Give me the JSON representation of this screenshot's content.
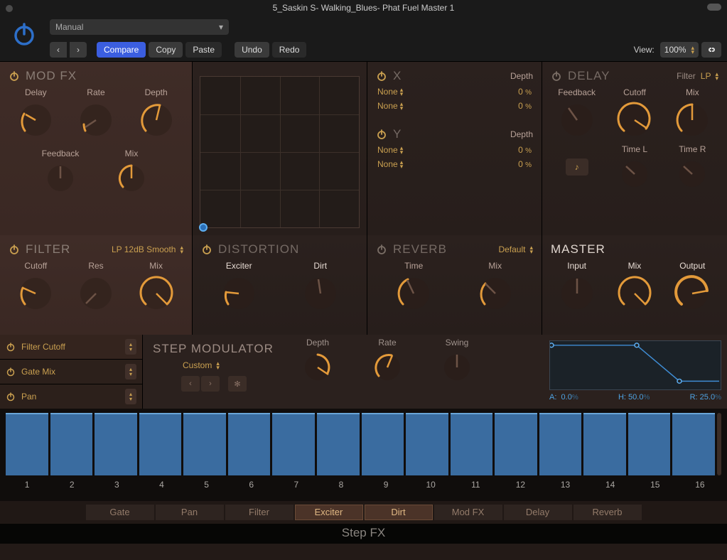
{
  "window_title": "5_Saskin S- Walking_Blues- Phat Fuel Master 1",
  "preset_name": "Manual",
  "toolbar": {
    "compare": "Compare",
    "copy": "Copy",
    "paste": "Paste",
    "undo": "Undo",
    "redo": "Redo",
    "view": "View:",
    "zoom": "100%"
  },
  "modfx": {
    "title": "MOD FX",
    "delay": "Delay",
    "rate": "Rate",
    "depth": "Depth",
    "feedback": "Feedback",
    "mix": "Mix"
  },
  "xy": {
    "x": "X",
    "y": "Y",
    "depth": "Depth",
    "none": "None",
    "vals": [
      "0",
      "0",
      "0",
      "0"
    ],
    "unit": "%"
  },
  "delay": {
    "title": "DELAY",
    "filter_label": "Filter",
    "filter_value": "LP",
    "feedback": "Feedback",
    "cutoff": "Cutoff",
    "mix": "Mix",
    "timeL": "Time L",
    "timeR": "Time R"
  },
  "filter": {
    "title": "FILTER",
    "mode": "LP 12dB Smooth",
    "cutoff": "Cutoff",
    "res": "Res",
    "mix": "Mix"
  },
  "distortion": {
    "title": "DISTORTION",
    "exciter": "Exciter",
    "dirt": "Dirt"
  },
  "reverb": {
    "title": "REVERB",
    "preset": "Default",
    "time": "Time",
    "mix": "Mix"
  },
  "master": {
    "title": "MASTER",
    "input": "Input",
    "mix": "Mix",
    "output": "Output"
  },
  "slots": [
    "Filter Cutoff",
    "Gate Mix",
    "Pan"
  ],
  "stepmod": {
    "title": "STEP MODULATOR",
    "preset": "Custom",
    "depth": "Depth",
    "rate": "Rate",
    "swing": "Swing"
  },
  "env": {
    "a_label": "A:",
    "a_val": "0.0",
    "h_label": "H:",
    "h_val": "50.0",
    "r_label": "R:",
    "r_val": "25.0",
    "unit": "%"
  },
  "steps": [
    "1",
    "2",
    "3",
    "4",
    "5",
    "6",
    "7",
    "8",
    "9",
    "10",
    "11",
    "12",
    "13",
    "14",
    "15",
    "16"
  ],
  "tabs": [
    "Gate",
    "Pan",
    "Filter",
    "Exciter",
    "Dirt",
    "Mod FX",
    "Delay",
    "Reverb"
  ],
  "active_tabs": [
    "Exciter",
    "Dirt"
  ],
  "footer": "Step FX"
}
